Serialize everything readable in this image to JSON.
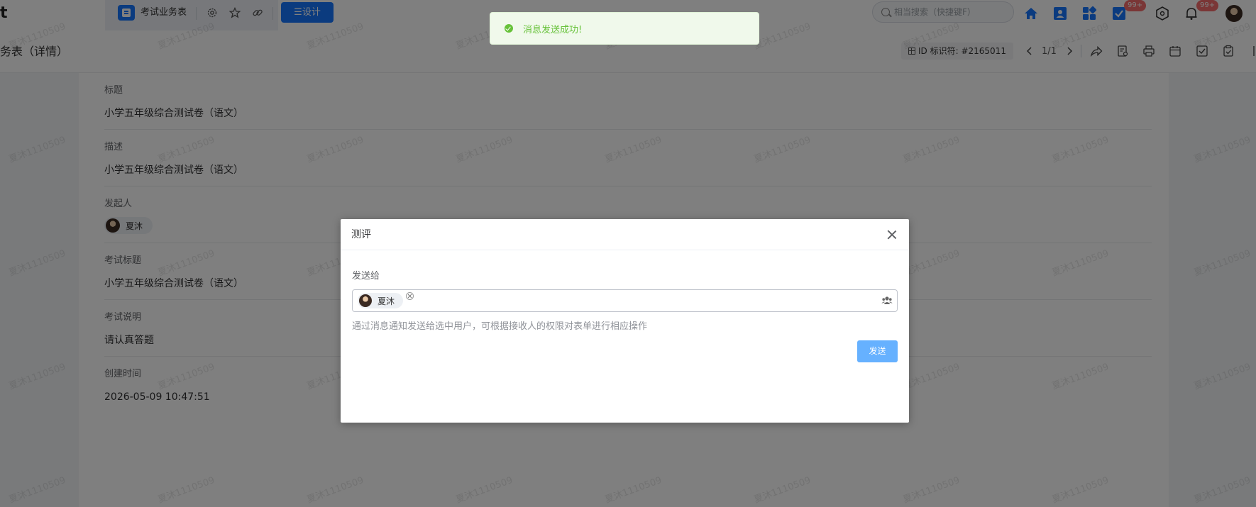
{
  "topbar": {
    "logo_fragment": "t",
    "app_name": "考试业务表",
    "design_label": "设计",
    "search_placeholder": "相当搜索（快捷键F）",
    "badges": {
      "tasks": "99+",
      "notifications": "99+"
    }
  },
  "page": {
    "title": "务表（详情）",
    "record_id": "ID 标识符: #2165011",
    "pager": "1/1"
  },
  "fields": [
    {
      "label": "标题",
      "value": "小学五年级综合测试卷（语文）"
    },
    {
      "label": "描述",
      "value": "小学五年级综合测试卷（语文）"
    },
    {
      "label": "发起人",
      "value": "夏沐"
    },
    {
      "label": "考试标题",
      "value": "小学五年级综合测试卷（语文）"
    },
    {
      "label": "考试说明",
      "value": "请认真答题"
    },
    {
      "label": "创建时间",
      "value": "2026-05-09 10:47:51"
    }
  ],
  "toast": {
    "message": "消息发送成功!"
  },
  "dialog": {
    "title": "测评",
    "send_to_label": "发送给",
    "recipient": "夏沐",
    "hint": "通过消息通知发送给选中用户，可根据接收人的权限对表单进行相应操作",
    "send_button": "发送"
  },
  "watermark": "夏沐1110509",
  "colors": {
    "primary": "#1677ff",
    "send_button": "#66b1ff",
    "success": "#67c23a",
    "badge": "#f56c6c"
  }
}
